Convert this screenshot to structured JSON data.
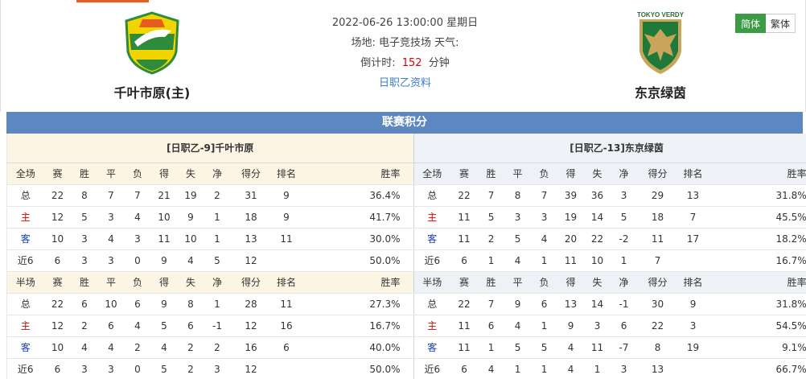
{
  "header": {
    "datetime": "2022-06-26 13:00:00 星期日",
    "venue_line": "场地: 电子竞技场 天气:",
    "countdown_label": "倒计时:",
    "countdown_value": "152",
    "countdown_unit": "分钟",
    "league_link": "日职乙资料",
    "home_team": "千叶市原(主)",
    "away_team": "东京绿茵",
    "away_logo_text": "TOKYO VERDY",
    "lang_simplified": "简体",
    "lang_traditional": "繁体",
    "colors": {
      "accent_green": "#3d9a45",
      "title_blue": "#5d87c0",
      "red": "#e00000"
    }
  },
  "section_title": "联赛积分",
  "left": {
    "caption": "[日职乙-9]千叶市原",
    "full_header": [
      "全场",
      "赛",
      "胜",
      "平",
      "负",
      "得",
      "失",
      "净",
      "得分",
      "排名",
      "胜率"
    ],
    "full_rows": [
      [
        "总",
        "22",
        "8",
        "7",
        "7",
        "21",
        "19",
        "2",
        "31",
        "9",
        "36.4%"
      ],
      [
        "主",
        "12",
        "5",
        "3",
        "4",
        "10",
        "9",
        "1",
        "18",
        "9",
        "41.7%"
      ],
      [
        "客",
        "10",
        "3",
        "4",
        "3",
        "11",
        "10",
        "1",
        "13",
        "11",
        "30.0%"
      ],
      [
        "近6",
        "6",
        "3",
        "3",
        "0",
        "9",
        "4",
        "5",
        "12",
        "",
        "50.0%"
      ]
    ],
    "half_header": [
      "半场",
      "赛",
      "胜",
      "平",
      "负",
      "得",
      "失",
      "净",
      "得分",
      "排名",
      "胜率"
    ],
    "half_rows": [
      [
        "总",
        "22",
        "6",
        "10",
        "6",
        "9",
        "8",
        "1",
        "28",
        "11",
        "27.3%"
      ],
      [
        "主",
        "12",
        "2",
        "6",
        "4",
        "5",
        "6",
        "-1",
        "12",
        "16",
        "16.7%"
      ],
      [
        "客",
        "10",
        "4",
        "4",
        "2",
        "4",
        "2",
        "2",
        "16",
        "6",
        "40.0%"
      ],
      [
        "近6",
        "6",
        "3",
        "3",
        "0",
        "5",
        "2",
        "3",
        "12",
        "",
        "50.0%"
      ]
    ]
  },
  "right": {
    "caption": "[日职乙-13]东京绿茵",
    "full_header": [
      "全场",
      "赛",
      "胜",
      "平",
      "负",
      "得",
      "失",
      "净",
      "得分",
      "排名",
      "胜率"
    ],
    "full_rows": [
      [
        "总",
        "22",
        "7",
        "8",
        "7",
        "39",
        "36",
        "3",
        "29",
        "13",
        "31.8%"
      ],
      [
        "主",
        "11",
        "5",
        "3",
        "3",
        "19",
        "14",
        "5",
        "18",
        "7",
        "45.5%"
      ],
      [
        "客",
        "11",
        "2",
        "5",
        "4",
        "20",
        "22",
        "-2",
        "11",
        "17",
        "18.2%"
      ],
      [
        "近6",
        "6",
        "1",
        "4",
        "1",
        "11",
        "10",
        "1",
        "7",
        "",
        "16.7%"
      ]
    ],
    "half_header": [
      "半场",
      "赛",
      "胜",
      "平",
      "负",
      "得",
      "失",
      "净",
      "得分",
      "排名",
      "胜率"
    ],
    "half_rows": [
      [
        "总",
        "22",
        "7",
        "9",
        "6",
        "13",
        "14",
        "-1",
        "30",
        "9",
        "31.8%"
      ],
      [
        "主",
        "11",
        "6",
        "4",
        "1",
        "9",
        "3",
        "6",
        "22",
        "3",
        "54.5%"
      ],
      [
        "客",
        "11",
        "1",
        "5",
        "5",
        "4",
        "11",
        "-7",
        "8",
        "19",
        "9.1%"
      ],
      [
        "近6",
        "6",
        "4",
        "1",
        "1",
        "4",
        "1",
        "3",
        "13",
        "",
        "66.7%"
      ]
    ]
  }
}
